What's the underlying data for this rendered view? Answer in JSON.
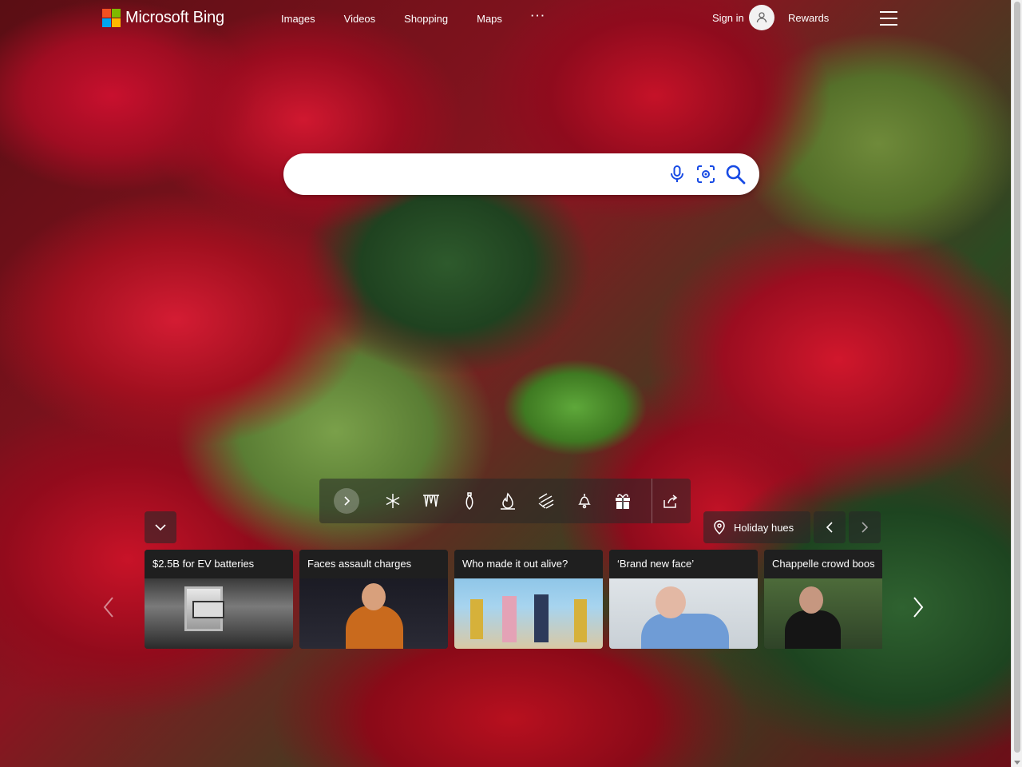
{
  "header": {
    "logo_text": "Microsoft Bing",
    "nav": [
      "Images",
      "Videos",
      "Shopping",
      "Maps",
      "···"
    ],
    "sign_in": "Sign in",
    "rewards": "Rewards"
  },
  "search": {
    "value": "",
    "placeholder": "",
    "icons": [
      "microphone-icon",
      "visual-search-icon",
      "search-icon"
    ]
  },
  "theme_toolbar": {
    "icons": [
      "chevron-right-icon",
      "snowflake-icon",
      "icicles-icon",
      "ornament-icon",
      "fireplace-icon",
      "snow-icon",
      "bell-icon",
      "gift-icon",
      "share-icon"
    ]
  },
  "image_info": {
    "label": "Holiday hues"
  },
  "news": [
    {
      "title": "$2.5B for EV batteries"
    },
    {
      "title": "Faces assault charges"
    },
    {
      "title": "Who made it out alive?"
    },
    {
      "title": "‘Brand new face’"
    },
    {
      "title": "Chappelle crowd boos"
    }
  ],
  "colors": {
    "ms_red": "#f25022",
    "ms_green": "#7fba00",
    "ms_blue": "#00a4ef",
    "ms_yellow": "#ffb900",
    "search_icon_blue": "#174ae4"
  }
}
